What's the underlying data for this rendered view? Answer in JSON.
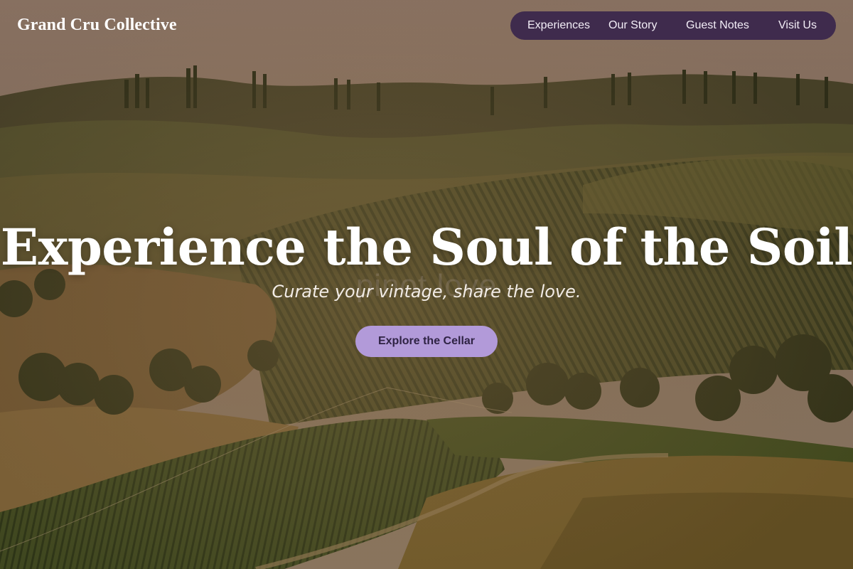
{
  "header": {
    "brand": "Grand Cru Collective",
    "nav": [
      {
        "label": "Experiences"
      },
      {
        "label": "Our Story"
      },
      {
        "label": "Guest Notes"
      },
      {
        "label": "Visit Us"
      }
    ]
  },
  "hero": {
    "title": "Experience the Soul of the Soil",
    "subtitle": "Curate your vintage, share the love.",
    "watermark": "pinot love",
    "cta_label": "Explore the Cellar",
    "background_image": "vineyard-hills-photo"
  },
  "colors": {
    "nav_background": "#3f2b4d",
    "cta_background": "#b29ad9",
    "cta_text": "#2f2344",
    "text_light": "#ffffff"
  }
}
